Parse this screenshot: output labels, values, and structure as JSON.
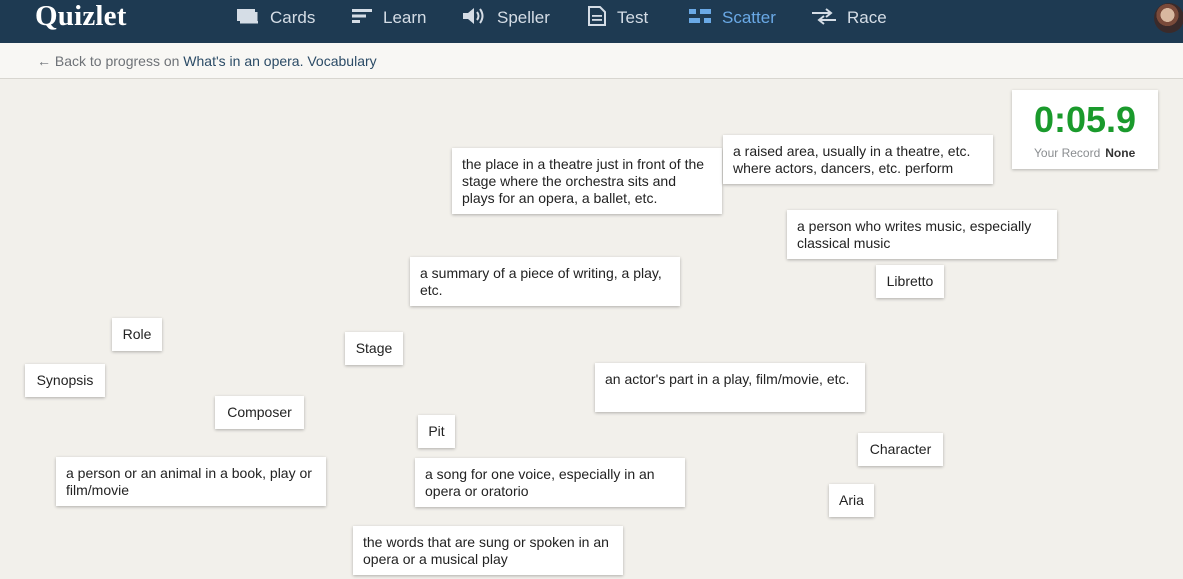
{
  "header": {
    "logo": "Quizlet",
    "nav": [
      {
        "id": "cards",
        "label": "Cards",
        "icon": "cards-icon"
      },
      {
        "id": "learn",
        "label": "Learn",
        "icon": "learn-icon"
      },
      {
        "id": "speller",
        "label": "Speller",
        "icon": "speaker-icon"
      },
      {
        "id": "test",
        "label": "Test",
        "icon": "document-icon"
      },
      {
        "id": "scatter",
        "label": "Scatter",
        "icon": "scatter-icon",
        "active": true
      },
      {
        "id": "race",
        "label": "Race",
        "icon": "race-icon"
      }
    ],
    "avatar": "user-avatar"
  },
  "subbar": {
    "back_prefix": "← Back to progress on",
    "set_name": "What's in an opera. Vocabulary"
  },
  "timer": {
    "value": "0:05.9",
    "record_label": "Your Record",
    "record_value": "None"
  },
  "cards": [
    {
      "text": "the place in a theatre just in front of the stage where the orchestra sits and plays for an opera, a ballet, etc.",
      "kind": "definition"
    },
    {
      "text": "a raised area, usually in a theatre, etc. where actors, dancers, etc. perform",
      "kind": "definition"
    },
    {
      "text": "a person who writes music, especially classical music",
      "kind": "definition"
    },
    {
      "text": "Libretto",
      "kind": "term"
    },
    {
      "text": "a summary of a piece of writing, a play, etc.",
      "kind": "definition"
    },
    {
      "text": "Role",
      "kind": "term"
    },
    {
      "text": "Stage",
      "kind": "term"
    },
    {
      "text": "Synopsis",
      "kind": "term"
    },
    {
      "text": "an actor's part in a play, film/movie, etc.",
      "kind": "definition"
    },
    {
      "text": "Composer",
      "kind": "term"
    },
    {
      "text": "Pit",
      "kind": "term"
    },
    {
      "text": "Character",
      "kind": "term"
    },
    {
      "text": "a person or an animal in a book, play or film/movie",
      "kind": "definition"
    },
    {
      "text": "a song for one voice, especially in an opera or oratorio",
      "kind": "definition"
    },
    {
      "text": "Aria",
      "kind": "term"
    },
    {
      "text": "the words that are sung or spoken in an opera or a musical play",
      "kind": "definition"
    }
  ]
}
